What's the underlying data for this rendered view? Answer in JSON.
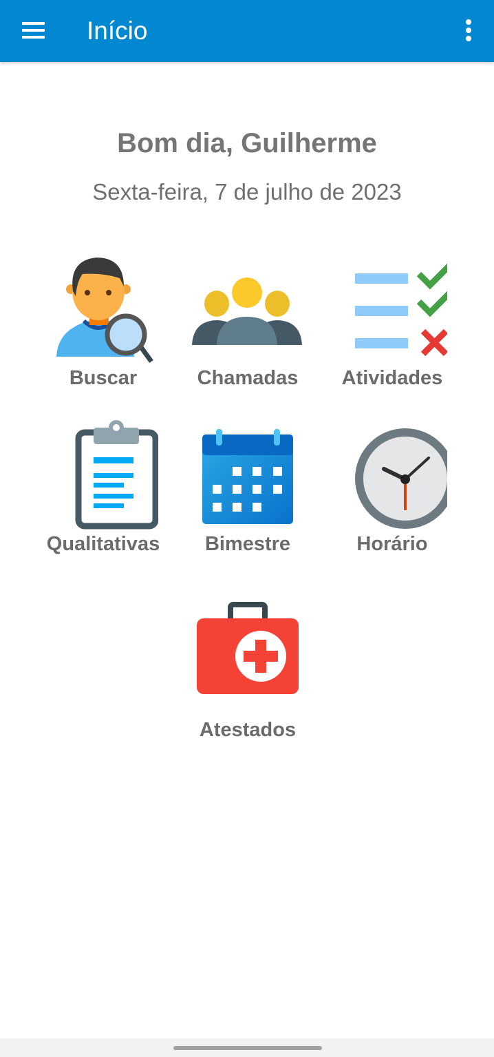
{
  "appbar": {
    "title": "Início",
    "menu_icon": "hamburger-menu-icon",
    "more_icon": "more-vertical-icon"
  },
  "greeting": {
    "title": "Bom dia, Guilherme",
    "date": "Sexta-feira, 7 de julho de 2023"
  },
  "tiles": [
    {
      "label": "Buscar",
      "icon": "person-search-icon"
    },
    {
      "label": "Chamadas",
      "icon": "group-icon"
    },
    {
      "label": "Atividades",
      "icon": "checklist-icon"
    },
    {
      "label": "Qualitativas",
      "icon": "clipboard-icon"
    },
    {
      "label": "Bimestre",
      "icon": "calendar-icon"
    },
    {
      "label": "Horário",
      "icon": "clock-icon"
    },
    {
      "label": "Atestados",
      "icon": "medical-kit-icon"
    }
  ],
  "colors": {
    "primary": "#0288d1",
    "text": "#757575"
  }
}
